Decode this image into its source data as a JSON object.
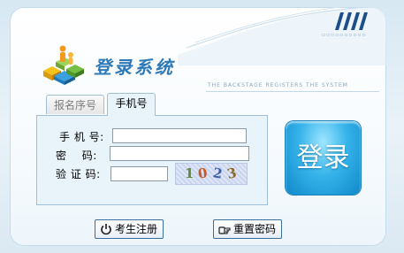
{
  "header": {
    "title": "登录系统",
    "subtitle": "THE BACKSTAGE REGISTERS THE SYSTEM",
    "decoration_dots": "▫▫▫▫▫▫▫▫▫▫"
  },
  "tabs": [
    {
      "label": "报名序号",
      "active": false
    },
    {
      "label": "手机号",
      "active": true
    }
  ],
  "form": {
    "phone_label": "手 机 号:",
    "password_label": "密    码:",
    "captcha_label": "验 证 码:",
    "phone_value": "",
    "password_value": "",
    "captcha_value": "",
    "captcha_chars": [
      "1",
      "0",
      "2",
      "3"
    ],
    "captcha_colors": [
      "#5a8a3a",
      "#c25a2a",
      "#3a5fa8",
      "#8a6a2a"
    ]
  },
  "buttons": {
    "login": "登录",
    "register": "考生注册",
    "reset_password": "重置密码"
  },
  "icons": {
    "register": "power-icon",
    "reset_password": "hand-pointer-icon",
    "logo": "people-on-cubes-logo"
  },
  "colors": {
    "title": "#2e7ab8",
    "login_button": "#36b4ea",
    "form_background": "#e9f4fa",
    "border": "#9fbfd6"
  }
}
